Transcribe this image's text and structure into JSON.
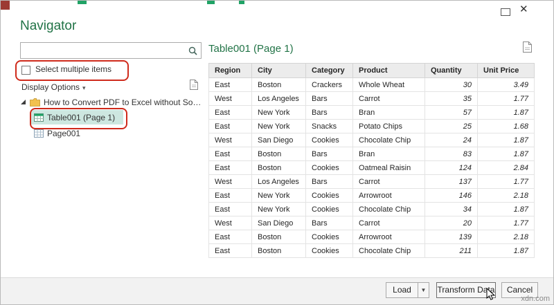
{
  "window": {
    "controls": {
      "close": "✕"
    },
    "watermark": "xdn.com"
  },
  "navigator": {
    "title": "Navigator",
    "search_placeholder": "",
    "select_multiple_label": "Select multiple items",
    "display_options_label": "Display Options",
    "display_options_caret": "▾",
    "tree": {
      "root_label": "How to Convert PDF to Excel without Software...",
      "items": [
        {
          "label": "Table001 (Page 1)",
          "selected": true
        },
        {
          "label": "Page001",
          "selected": false
        }
      ]
    }
  },
  "preview": {
    "title": "Table001 (Page 1)",
    "columns": [
      "Region",
      "City",
      "Category",
      "Product",
      "Quantity",
      "Unit Price"
    ],
    "rows": [
      [
        "East",
        "Boston",
        "Crackers",
        "Whole Wheat",
        "30",
        "3.49"
      ],
      [
        "West",
        "Los Angeles",
        "Bars",
        "Carrot",
        "35",
        "1.77"
      ],
      [
        "East",
        "New York",
        "Bars",
        "Bran",
        "57",
        "1.87"
      ],
      [
        "East",
        "New York",
        "Snacks",
        "Potato Chips",
        "25",
        "1.68"
      ],
      [
        "West",
        "San Diego",
        "Cookies",
        "Chocolate Chip",
        "24",
        "1.87"
      ],
      [
        "East",
        "Boston",
        "Bars",
        "Bran",
        "83",
        "1.87"
      ],
      [
        "East",
        "Boston",
        "Cookies",
        "Oatmeal Raisin",
        "124",
        "2.84"
      ],
      [
        "West",
        "Los Angeles",
        "Bars",
        "Carrot",
        "137",
        "1.77"
      ],
      [
        "East",
        "New York",
        "Cookies",
        "Arrowroot",
        "146",
        "2.18"
      ],
      [
        "East",
        "New York",
        "Cookies",
        "Chocolate Chip",
        "34",
        "1.87"
      ],
      [
        "West",
        "San Diego",
        "Bars",
        "Carrot",
        "20",
        "1.77"
      ],
      [
        "East",
        "Boston",
        "Cookies",
        "Arrowroot",
        "139",
        "2.18"
      ],
      [
        "East",
        "Boston",
        "Cookies",
        "Chocolate Chip",
        "211",
        "1.87"
      ]
    ]
  },
  "footer": {
    "load_label": "Load",
    "load_arrow": "▼",
    "transform_label": "Transform Data",
    "cancel_label": "Cancel"
  },
  "colors": {
    "title_green": "#217346",
    "selection_teal": "#cde7e0",
    "annotation_red": "#cf2a1b",
    "accent_green": "#21a366"
  }
}
